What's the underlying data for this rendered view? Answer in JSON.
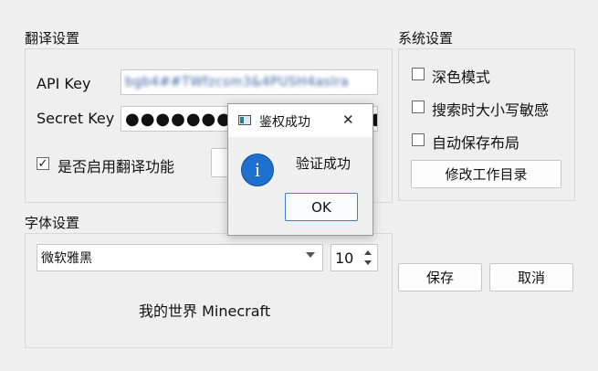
{
  "translate_settings": {
    "title": "翻译设置",
    "api_key_label": "API Key",
    "api_key_value": "bgb4##TWfzcsm3&4PUSH4aslra",
    "secret_key_label": "Secret Key",
    "secret_key_value": "●●●●●●●●●●●●●●●●●●●●●●●",
    "enable_label": "是否启用翻译功能",
    "enable_checked": true
  },
  "system_settings": {
    "title": "系统设置",
    "dark_mode_label": "深色模式",
    "case_sensitive_label": "搜索时大小写敏感",
    "autosave_layout_label": "自动保存布局",
    "change_workdir_label": "修改工作目录"
  },
  "font_settings": {
    "title": "字体设置",
    "font_family_value": "微软雅黑",
    "font_size_value": "10",
    "preview_text": "我的世界 Minecraft"
  },
  "actions": {
    "save_label": "保存",
    "cancel_label": "取消"
  },
  "dialog": {
    "title": "鉴权成功",
    "message": "验证成功",
    "ok_label": "OK",
    "close_glyph": "✕",
    "info_glyph": "i"
  },
  "colors": {
    "background": "#f0f0f0",
    "info_blue": "#1f6fcf",
    "ok_border": "#3c7fd6"
  }
}
